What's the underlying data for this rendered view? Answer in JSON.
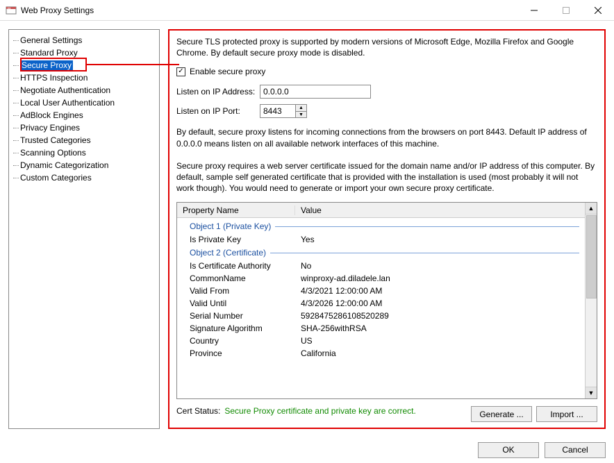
{
  "window": {
    "title": "Web Proxy Settings"
  },
  "sidebar": {
    "items": [
      {
        "label": "General Settings"
      },
      {
        "label": "Standard Proxy"
      },
      {
        "label": "Secure Proxy",
        "selected": true
      },
      {
        "label": "HTTPS Inspection"
      },
      {
        "label": "Negotiate Authentication"
      },
      {
        "label": "Local User Authentication"
      },
      {
        "label": "AdBlock Engines"
      },
      {
        "label": "Privacy Engines"
      },
      {
        "label": "Trusted Categories"
      },
      {
        "label": "Scanning Options"
      },
      {
        "label": "Dynamic Categorization"
      },
      {
        "label": "Custom Categories"
      }
    ]
  },
  "panel": {
    "intro": "Secure TLS protected proxy is supported by modern versions of Microsoft Edge, Mozilla Firefox and Google Chrome. By default secure proxy mode is disabled.",
    "enable_label": "Enable secure proxy",
    "enable_checked": true,
    "listen_ip_label": "Listen on IP Address:",
    "listen_ip_value": "0.0.0.0",
    "listen_port_label": "Listen on IP Port:",
    "listen_port_value": "8443",
    "default_note": "By default, secure proxy listens for incoming connections from the browsers on port 8443. Default IP address of 0.0.0.0 means listen on all available network interfaces of this machine.",
    "cert_note": "Secure proxy requires a web server certificate issued for the domain name and/or IP address of this computer. By default, sample self generated certificate that is provided with the installation is used (most probably it will not work though). You would need to generate or import your own secure proxy certificate.",
    "grid": {
      "col_name": "Property Name",
      "col_value": "Value",
      "section1": "Object 1 (Private Key)",
      "rows1": [
        {
          "name": "Is Private Key",
          "value": "Yes"
        }
      ],
      "section2": "Object 2 (Certificate)",
      "rows2": [
        {
          "name": "Is Certificate Authority",
          "value": "No"
        },
        {
          "name": "CommonName",
          "value": "winproxy-ad.diladele.lan"
        },
        {
          "name": "Valid From",
          "value": "4/3/2021 12:00:00 AM"
        },
        {
          "name": "Valid Until",
          "value": "4/3/2026 12:00:00 AM"
        },
        {
          "name": "Serial Number",
          "value": "5928475286108520289"
        },
        {
          "name": "Signature Algorithm",
          "value": "SHA-256withRSA"
        },
        {
          "name": "Country",
          "value": "US"
        },
        {
          "name": "Province",
          "value": "California"
        }
      ]
    },
    "cert_status_label": "Cert Status:",
    "cert_status_msg": "Secure Proxy certificate and private key are correct.",
    "generate_label": "Generate ...",
    "import_label": "Import ..."
  },
  "dialog": {
    "ok": "OK",
    "cancel": "Cancel"
  }
}
